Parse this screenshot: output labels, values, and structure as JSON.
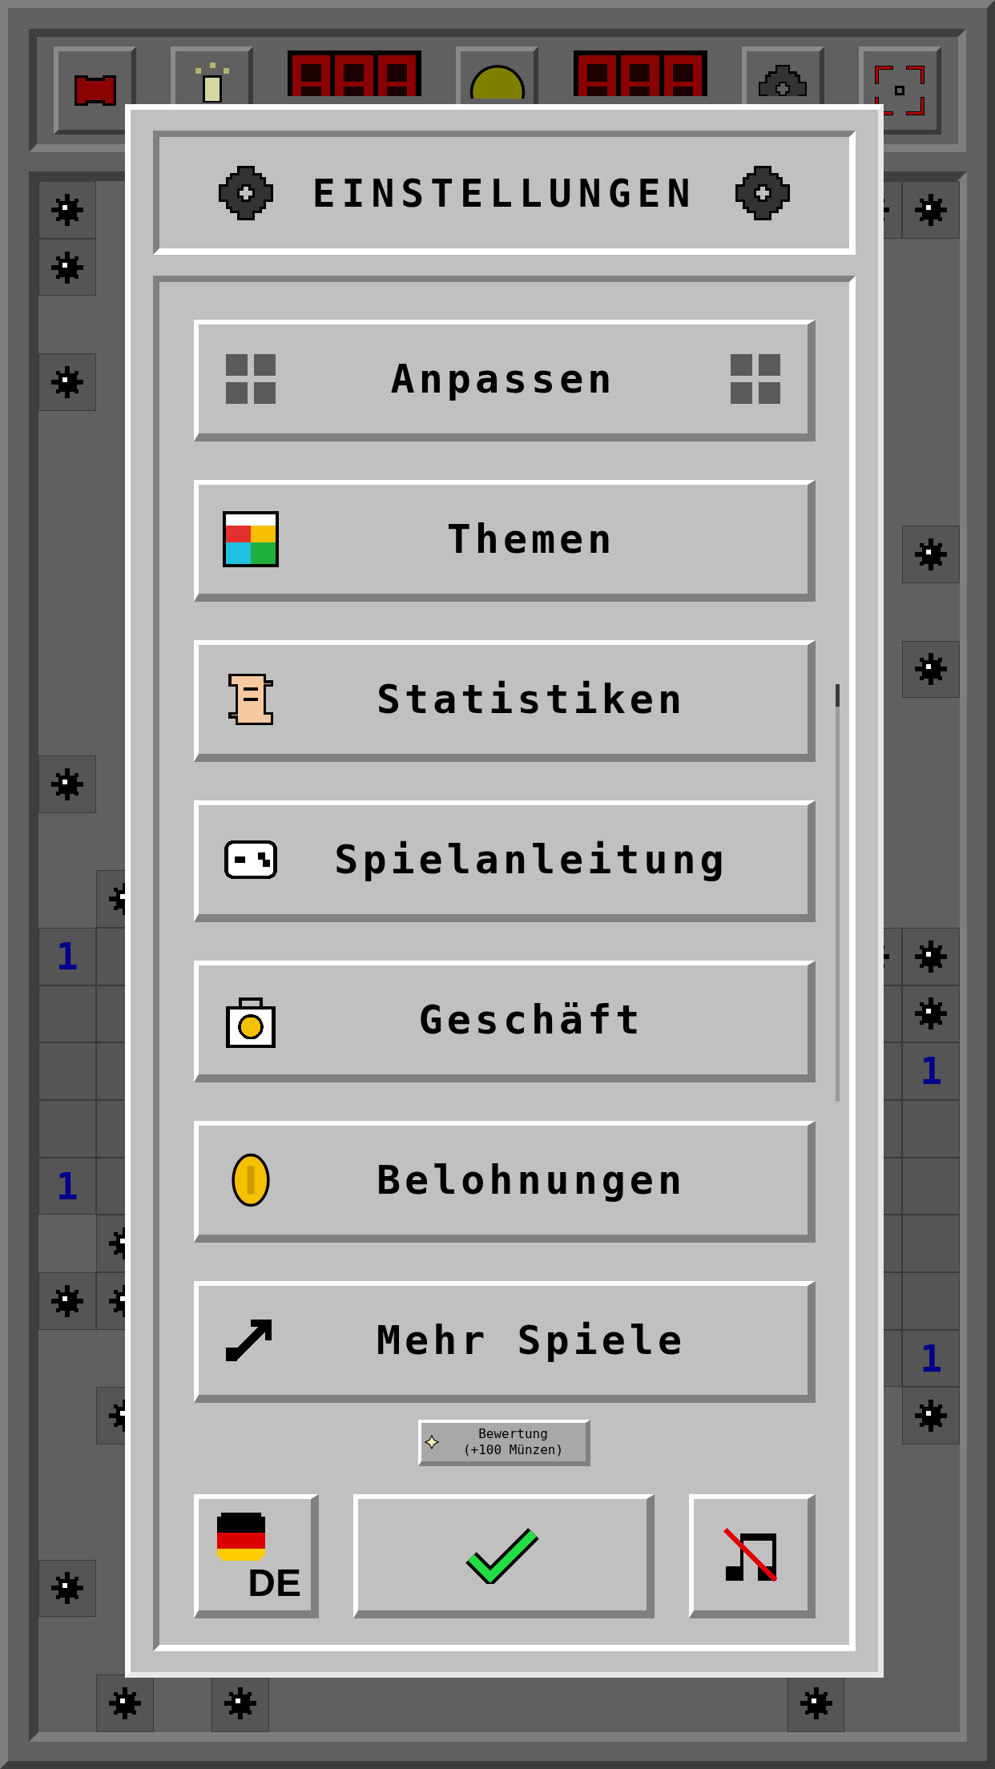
{
  "toolbar": [
    {
      "kind": "flag"
    },
    {
      "kind": "hint"
    },
    {
      "kind": "counter"
    },
    {
      "kind": "face"
    },
    {
      "kind": "counter"
    },
    {
      "kind": "settings"
    },
    {
      "kind": "fullscreen"
    }
  ],
  "board": {
    "rows": [
      {
        "left": [
          {
            "kind": "mine"
          },
          {
            "kind": "covered"
          }
        ],
        "right": [
          {
            "kind": "mine"
          },
          {
            "kind": "mine"
          }
        ]
      },
      {
        "left": [
          {
            "kind": "mine"
          },
          {
            "kind": "covered"
          }
        ],
        "right": [
          {
            "kind": "covered"
          },
          {
            "kind": "covered"
          }
        ]
      },
      {
        "left": [
          {
            "kind": "covered"
          },
          {
            "kind": "covered"
          }
        ],
        "right": [
          {
            "kind": "covered"
          },
          {
            "kind": "covered"
          }
        ]
      },
      {
        "left": [
          {
            "kind": "mine"
          },
          {
            "kind": "covered"
          }
        ],
        "right": [
          {
            "kind": "covered"
          },
          {
            "kind": "covered"
          }
        ]
      },
      {
        "left": [
          {
            "kind": "covered"
          },
          {
            "kind": "covered"
          }
        ],
        "right": [
          {
            "kind": "covered"
          },
          {
            "kind": "covered"
          }
        ]
      },
      {
        "left": [
          {
            "kind": "covered"
          },
          {
            "kind": "covered"
          }
        ],
        "right": [
          {
            "kind": "covered"
          },
          {
            "kind": "covered"
          }
        ]
      },
      {
        "left": [
          {
            "kind": "covered"
          },
          {
            "kind": "covered"
          }
        ],
        "right": [
          {
            "kind": "covered"
          },
          {
            "kind": "mine"
          }
        ]
      },
      {
        "left": [
          {
            "kind": "covered"
          },
          {
            "kind": "covered"
          }
        ],
        "right": [
          {
            "kind": "covered"
          },
          {
            "kind": "covered"
          }
        ]
      },
      {
        "left": [
          {
            "kind": "covered"
          },
          {
            "kind": "covered"
          }
        ],
        "right": [
          {
            "kind": "covered"
          },
          {
            "kind": "mine"
          }
        ]
      },
      {
        "left": [
          {
            "kind": "covered"
          },
          {
            "kind": "covered"
          }
        ],
        "right": [
          {
            "kind": "covered"
          },
          {
            "kind": "covered"
          }
        ]
      },
      {
        "left": [
          {
            "kind": "mine"
          },
          {
            "kind": "covered"
          }
        ],
        "right": [
          {
            "kind": "covered"
          },
          {
            "kind": "covered"
          }
        ]
      },
      {
        "left": [
          {
            "kind": "covered"
          },
          {
            "kind": "covered"
          }
        ],
        "right": [
          {
            "kind": "covered"
          },
          {
            "kind": "covered"
          }
        ]
      },
      {
        "left": [
          {
            "kind": "covered"
          },
          {
            "kind": "mine"
          }
        ],
        "right": [
          {
            "kind": "covered"
          },
          {
            "kind": "covered"
          }
        ]
      },
      {
        "left": [
          {
            "kind": "number",
            "text": "1",
            "color": "#00008b"
          },
          {
            "kind": "open"
          }
        ],
        "right": [
          {
            "kind": "mine"
          },
          {
            "kind": "mine"
          }
        ]
      },
      {
        "left": [
          {
            "kind": "open"
          },
          {
            "kind": "open"
          }
        ],
        "right": [
          {
            "kind": "open"
          },
          {
            "kind": "mine"
          }
        ]
      },
      {
        "left": [
          {
            "kind": "open"
          },
          {
            "kind": "open"
          }
        ],
        "right": [
          {
            "kind": "open"
          },
          {
            "kind": "number",
            "text": "1",
            "color": "#00008b"
          }
        ]
      },
      {
        "left": [
          {
            "kind": "open"
          },
          {
            "kind": "open"
          }
        ],
        "right": [
          {
            "kind": "open"
          },
          {
            "kind": "open"
          }
        ]
      },
      {
        "left": [
          {
            "kind": "number",
            "text": "1",
            "color": "#00008b"
          },
          {
            "kind": "open"
          }
        ],
        "right": [
          {
            "kind": "open"
          },
          {
            "kind": "open"
          }
        ]
      },
      {
        "left": [
          {
            "kind": "covered"
          },
          {
            "kind": "mine"
          }
        ],
        "right": [
          {
            "kind": "open"
          },
          {
            "kind": "open"
          }
        ]
      },
      {
        "left": [
          {
            "kind": "mine"
          },
          {
            "kind": "mine"
          }
        ],
        "right": [
          {
            "kind": "open"
          },
          {
            "kind": "open"
          }
        ]
      },
      {
        "left": [
          {
            "kind": "covered"
          },
          {
            "kind": "covered"
          }
        ],
        "right": [
          {
            "kind": "open"
          },
          {
            "kind": "number",
            "text": "1",
            "color": "#00008b"
          }
        ]
      },
      {
        "left": [
          {
            "kind": "covered"
          },
          {
            "kind": "mine"
          }
        ],
        "right": [
          {
            "kind": "covered"
          },
          {
            "kind": "mine"
          }
        ]
      },
      {
        "left": [
          {
            "kind": "covered"
          },
          {
            "kind": "covered"
          }
        ],
        "right": [
          {
            "kind": "covered"
          },
          {
            "kind": "covered"
          }
        ]
      },
      {
        "left": [
          {
            "kind": "covered"
          },
          {
            "kind": "covered"
          }
        ],
        "right": [
          {
            "kind": "covered"
          },
          {
            "kind": "covered"
          }
        ]
      },
      {
        "left": [
          {
            "kind": "mine"
          },
          {
            "kind": "covered"
          }
        ],
        "right": [
          {
            "kind": "covered"
          },
          {
            "kind": "covered"
          }
        ]
      },
      {
        "left": [
          {
            "kind": "covered"
          },
          {
            "kind": "covered"
          }
        ],
        "right": [
          {
            "kind": "covered"
          },
          {
            "kind": "covered"
          }
        ]
      }
    ],
    "bottom": [
      {
        "kind": "covered"
      },
      {
        "kind": "mine"
      },
      {
        "kind": "covered"
      },
      {
        "kind": "mine"
      },
      {
        "kind": "covered"
      },
      {
        "kind": "covered"
      },
      {
        "kind": "covered"
      },
      {
        "kind": "covered"
      },
      {
        "kind": "covered"
      },
      {
        "kind": "covered"
      },
      {
        "kind": "covered"
      },
      {
        "kind": "covered"
      },
      {
        "kind": "covered"
      },
      {
        "kind": "mine"
      },
      {
        "kind": "covered"
      },
      {
        "kind": "covered"
      }
    ]
  },
  "dialog": {
    "title": "EINSTELLUNGEN",
    "menu": [
      {
        "label": "Anpassen"
      },
      {
        "label": "Themen"
      },
      {
        "label": "Statistiken"
      },
      {
        "label": "Spielanleitung"
      },
      {
        "label": "Geschäft"
      },
      {
        "label": "Belohnungen"
      },
      {
        "label": "Mehr Spiele"
      }
    ],
    "rating": {
      "title": "Bewertung",
      "reward": "(+100 Münzen)"
    },
    "language": {
      "code": "DE"
    },
    "sound": {
      "muted": true
    }
  }
}
